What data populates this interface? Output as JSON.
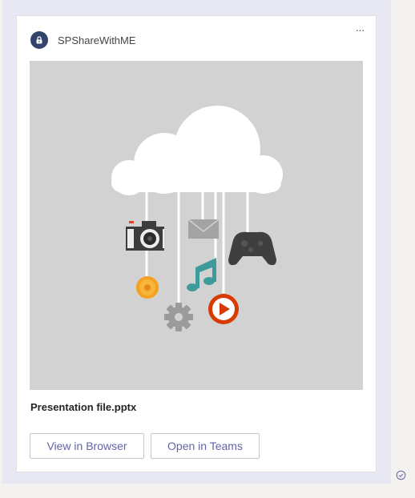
{
  "card": {
    "sender": "SPShareWithME",
    "more_label": "···",
    "file_name": "Presentation file.pptx",
    "hero_icons": [
      "cloud-icon",
      "camera-icon",
      "mail-icon",
      "game-controller-icon",
      "music-note-icon",
      "coin-icon",
      "gear-icon",
      "play-icon"
    ],
    "actions": {
      "view_browser": "View in Browser",
      "open_teams": "Open in Teams"
    }
  },
  "colors": {
    "accent": "#6264a7",
    "avatar": "#33446c",
    "hero_bg": "#d2d2d2"
  },
  "status": {
    "icon": "message-sent-icon"
  }
}
